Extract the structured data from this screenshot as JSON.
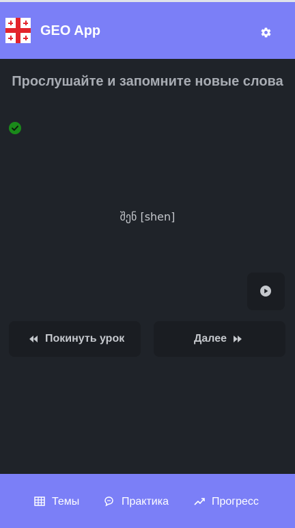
{
  "header": {
    "title": "GEO App",
    "logo_icon": "georgian-flag-icon",
    "settings_icon": "gear-icon"
  },
  "lesson": {
    "heading": "Прослушайте и запомните новые слова",
    "status_icon": "check-circle-icon",
    "word": "შენ [shen]",
    "play_icon": "play-circle-icon"
  },
  "buttons": {
    "leave_label": "Покинуть урок",
    "next_label": "Далее"
  },
  "footer": {
    "tabs": [
      {
        "label": "Темы",
        "icon": "table-icon"
      },
      {
        "label": "Практика",
        "icon": "chat-icon"
      },
      {
        "label": "Прогресс",
        "icon": "trend-up-icon"
      }
    ]
  },
  "colors": {
    "accent": "#7b7ff7",
    "background": "#1f2329",
    "button_bg": "#1a1d22",
    "success": "#1a8a1a",
    "flag_red": "#e3242b"
  }
}
